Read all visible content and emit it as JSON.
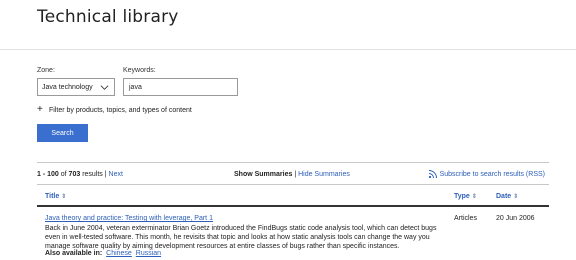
{
  "page": {
    "title": "Technical library"
  },
  "form": {
    "zone_label": "Zone:",
    "zone_value": "Java technology",
    "keywords_label": "Keywords:",
    "keywords_value": "java",
    "filter_label": "Filter by products, topics, and types of content",
    "search_button": "Search"
  },
  "results": {
    "range": "1 - 100",
    "of_text": "of",
    "total": "703",
    "results_text": "results |",
    "next_label": "Next",
    "show_summaries": "Show Summaries",
    "separator": "|",
    "hide_summaries": "Hide Summaries",
    "rss_label": "Subscribe to search results (RSS)"
  },
  "table": {
    "headers": {
      "title": "Title",
      "type": "Type",
      "date": "Date"
    },
    "sort_glyph": "⇕",
    "rows": [
      {
        "title": "Java theory and practice: Testing with leverage, Part 1",
        "description": "Back in June 2004, veteran exterminator Brian Goetz introduced the FindBugs static code analysis tool, which can detect bugs even in well-tested software. This month, he revisits that topic and looks at how static analysis tools can change the way you manage software quality by aiming development resources at entire classes of bugs rather than specific instances.",
        "also_available_label": "Also available in:",
        "languages": [
          "Chinese",
          "Russian"
        ],
        "type": "Articles",
        "date": "20 Jun 2006"
      }
    ]
  },
  "colors": {
    "link": "#2d5fb8",
    "button": "#3b6fcf"
  }
}
